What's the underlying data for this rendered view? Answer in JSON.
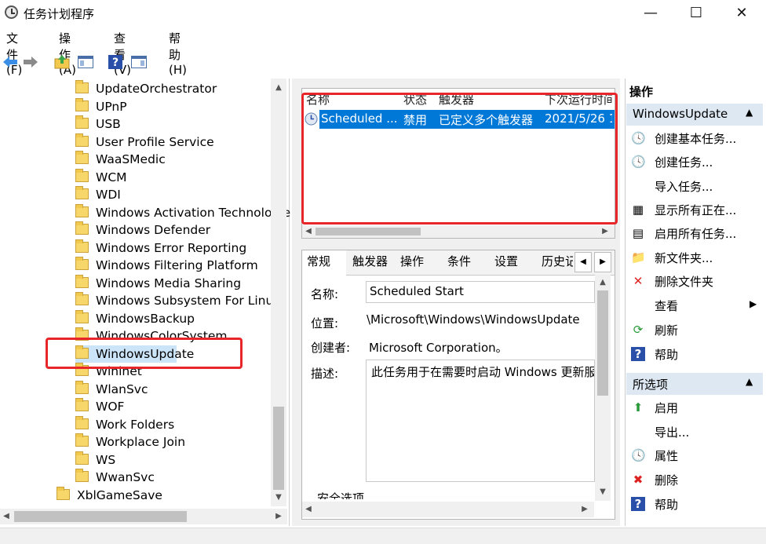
{
  "window": {
    "title": "任务计划程序",
    "minimize": "—",
    "maximize": "☐",
    "close": "✕"
  },
  "menu": [
    "文件(F)",
    "操作(A)",
    "查看(V)",
    "帮助(H)"
  ],
  "tree": {
    "items": [
      "UpdateOrchestrator",
      "UPnP",
      "USB",
      "User Profile Service",
      "WaaSMedic",
      "WCM",
      "WDI",
      "Windows Activation Technologie",
      "Windows Defender",
      "Windows Error Reporting",
      "Windows Filtering Platform",
      "Windows Media Sharing",
      "Windows Subsystem For Linux",
      "WindowsBackup",
      "WindowsColorSystem",
      "WindowsUpdate",
      "Wininet",
      "WlanSvc",
      "WOF",
      "Work Folders",
      "Workplace Join",
      "WS",
      "WwanSvc"
    ],
    "parent_item": "XblGameSave",
    "selected": "WindowsUpdate"
  },
  "task_list": {
    "columns": [
      "名称",
      "状态",
      "触发器",
      "下次运行时间"
    ],
    "rows": [
      {
        "name": "Scheduled ...",
        "status": "禁用",
        "trigger": "已定义多个触发器",
        "next_run": "2021/5/26 1"
      }
    ]
  },
  "detail": {
    "tabs": [
      "常规",
      "触发器",
      "操作",
      "条件",
      "设置",
      "历史记"
    ],
    "name_label": "名称:",
    "name_value": "Scheduled Start",
    "location_label": "位置:",
    "location_value": "\\Microsoft\\Windows\\WindowsUpdate",
    "author_label": "创建者:",
    "author_value": "Microsoft Corporation。",
    "desc_label": "描述:",
    "desc_value": "此任务用于在需要时启动 Windows 更新服务",
    "security_label": "安全选项"
  },
  "actions": {
    "header": "操作",
    "section1": "WindowsUpdate",
    "items1": [
      "创建基本任务...",
      "创建任务...",
      "导入任务...",
      "显示所有正在...",
      "启用所有任务...",
      "新文件夹...",
      "删除文件夹",
      "查看",
      "刷新",
      "帮助"
    ],
    "section2": "所选项",
    "items2": [
      "启用",
      "导出...",
      "属性",
      "删除",
      "帮助"
    ]
  },
  "colors": {
    "selection": "#0078d7",
    "highlight_box": "#e8262a",
    "section_header": "#dde8f3"
  }
}
